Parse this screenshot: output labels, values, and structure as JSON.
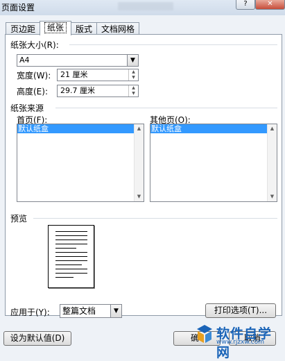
{
  "window": {
    "title": "页面设置",
    "help_label": "?",
    "close_label": "✕"
  },
  "tabs": [
    {
      "label": "页边距"
    },
    {
      "label": "纸张"
    },
    {
      "label": "版式"
    },
    {
      "label": "文档网格"
    }
  ],
  "paper_size": {
    "section_label": "纸张大小(R):",
    "selected": "A4",
    "width_label": "宽度(W):",
    "width_value": "21 厘米",
    "height_label": "高度(E):",
    "height_value": "29.7 厘米"
  },
  "paper_source": {
    "section_label": "纸张来源",
    "first_page_label": "首页(F):",
    "first_page_item": "默认纸盒",
    "other_pages_label": "其他页(O):",
    "other_pages_item": "默认纸盒"
  },
  "preview": {
    "section_label": "预览"
  },
  "apply_to": {
    "label": "应用于(Y):",
    "selected": "整篇文档"
  },
  "buttons": {
    "print_options": "打印选项(T)...",
    "set_default": "设为默认值(D)",
    "ok": "确",
    "cancel": "取消"
  },
  "watermark": {
    "brand": "软件自学网",
    "url": "www.rjzxw.com"
  },
  "colors": {
    "selection": "#3399ff",
    "window_bg": "#eef2f7",
    "brand": "#1a64b8"
  },
  "icons": {
    "dropdown": "chevron-down-icon",
    "spin": "spin-arrows-icon",
    "help": "question-icon",
    "close": "close-icon"
  }
}
